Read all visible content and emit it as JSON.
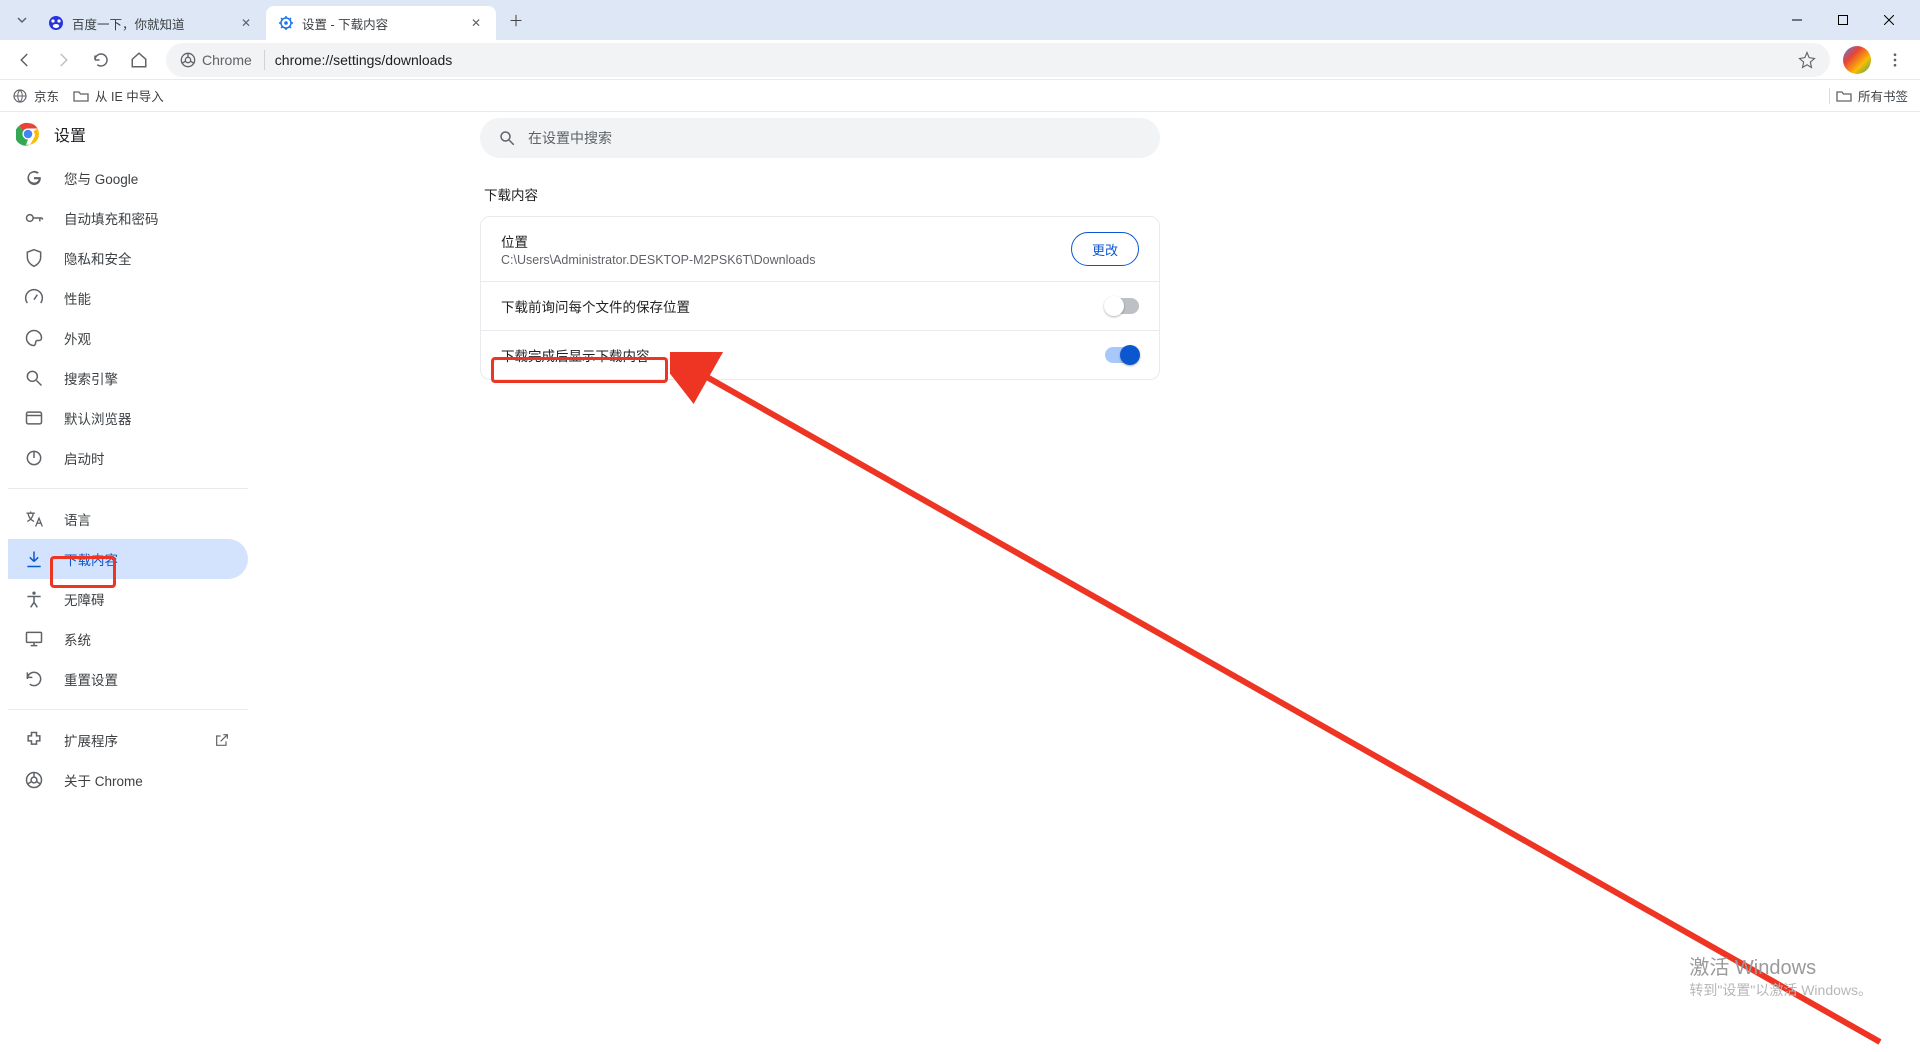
{
  "tabs": [
    {
      "title": "百度一下，你就知道"
    },
    {
      "title": "设置 - 下载内容"
    }
  ],
  "toolbar": {
    "chrome_chip": "Chrome",
    "url": "chrome://settings/downloads"
  },
  "bookmarks": {
    "items": [
      "京东",
      "从 IE 中导入"
    ],
    "all": "所有书签"
  },
  "settings": {
    "title": "设置",
    "search_placeholder": "在设置中搜索",
    "sidebar": [
      "您与 Google",
      "自动填充和密码",
      "隐私和安全",
      "性能",
      "外观",
      "搜索引擎",
      "默认浏览器",
      "启动时",
      "语言",
      "下载内容",
      "无障碍",
      "系统",
      "重置设置",
      "扩展程序",
      "关于 Chrome"
    ],
    "section_title": "下载内容",
    "location_label": "位置",
    "location_path": "C:\\Users\\Administrator.DESKTOP-M2PSK6T\\Downloads",
    "change_btn": "更改",
    "row_ask": "下载前询问每个文件的保存位置",
    "row_show": "下载完成后显示下载内容"
  },
  "watermark": {
    "line1": "激活 Windows",
    "line2": "转到\"设置\"以激活 Windows。"
  }
}
